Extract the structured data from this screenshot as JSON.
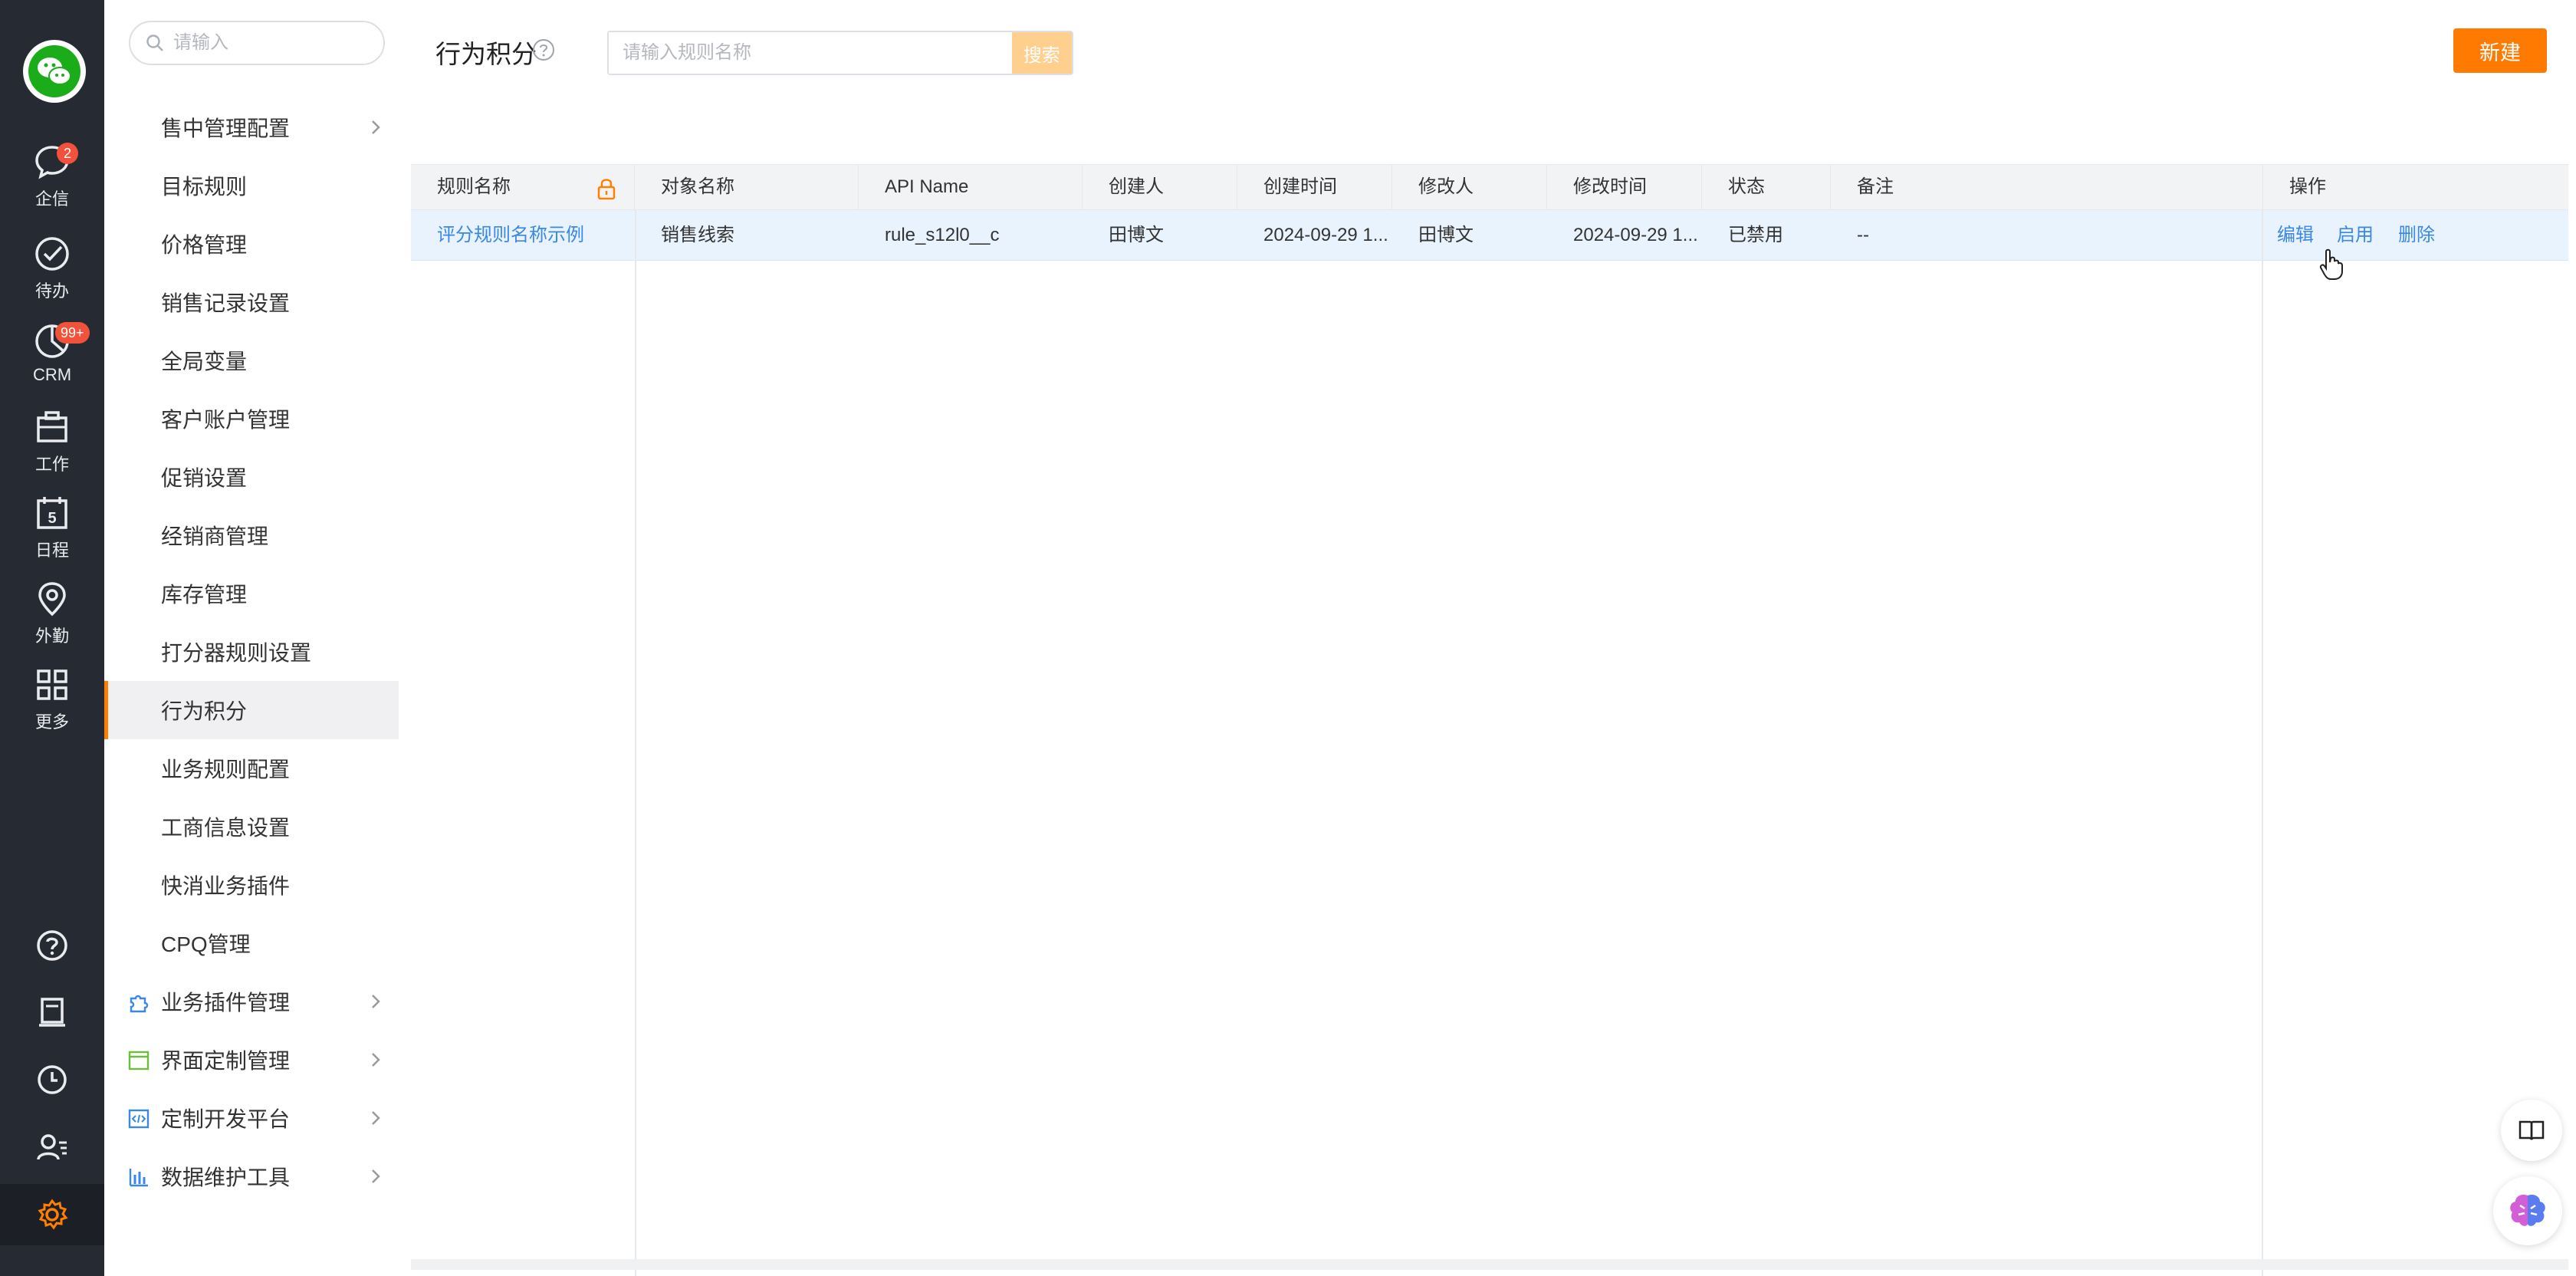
{
  "rail": {
    "items": [
      {
        "label": "企信",
        "icon": "chat-bubble-icon",
        "badge": "2"
      },
      {
        "label": "待办",
        "icon": "check-circle-icon",
        "badge": ""
      },
      {
        "label": "CRM",
        "icon": "pie-chart-icon",
        "badge": "99+"
      },
      {
        "label": "工作",
        "icon": "briefcase-icon",
        "badge": ""
      },
      {
        "label": "日程",
        "icon": "calendar-icon",
        "badge": "",
        "day": "5"
      },
      {
        "label": "外勤",
        "icon": "location-pin-icon",
        "badge": ""
      },
      {
        "label": "更多",
        "icon": "grid-icon",
        "badge": ""
      }
    ],
    "bottom_icons": [
      "help-icon",
      "document-icon",
      "clock-icon",
      "user-list-icon"
    ],
    "settings_icon": "gear-icon",
    "accent_color": "#ff8000"
  },
  "sidebar": {
    "search_placeholder": "请输入",
    "items": [
      {
        "label": "售中管理配置",
        "chevron": true
      },
      {
        "label": "目标规则"
      },
      {
        "label": "价格管理"
      },
      {
        "label": "销售记录设置"
      },
      {
        "label": "全局变量"
      },
      {
        "label": "客户账户管理"
      },
      {
        "label": "促销设置"
      },
      {
        "label": "经销商管理"
      },
      {
        "label": "库存管理"
      },
      {
        "label": "打分器规则设置"
      },
      {
        "label": "行为积分",
        "active": true
      },
      {
        "label": "业务规则配置"
      },
      {
        "label": "工商信息设置"
      },
      {
        "label": "快消业务插件"
      },
      {
        "label": "CPQ管理"
      }
    ],
    "groups": [
      {
        "label": "业务插件管理",
        "icon": "puzzle-icon",
        "color": "#3a87e6"
      },
      {
        "label": "界面定制管理",
        "icon": "window-icon",
        "color": "#6bbf3a"
      },
      {
        "label": "定制开发平台",
        "icon": "code-icon",
        "color": "#3a87e6"
      },
      {
        "label": "数据维护工具",
        "icon": "bar-chart-icon",
        "color": "#3a87e6"
      }
    ]
  },
  "main": {
    "title": "行为积分",
    "search_placeholder": "请输入规则名称",
    "search_button": "搜索",
    "new_button": "新建",
    "columns": [
      "规则名称",
      "对象名称",
      "API Name",
      "创建人",
      "创建时间",
      "修改人",
      "修改时间",
      "状态",
      "备注",
      "操作"
    ],
    "rows": [
      {
        "rule_name": "评分规则名称示例",
        "object_name": "销售线索",
        "api_name": "rule_s12l0__c",
        "creator": "田博文",
        "created_at": "2024-09-29 1...",
        "modifier": "田博文",
        "modified_at": "2024-09-29 1...",
        "status": "已禁用",
        "remark": "--",
        "ops": [
          "编辑",
          "启用",
          "删除"
        ]
      }
    ],
    "link_color": "#3a87e6",
    "primary_color": "#ff7a00"
  }
}
